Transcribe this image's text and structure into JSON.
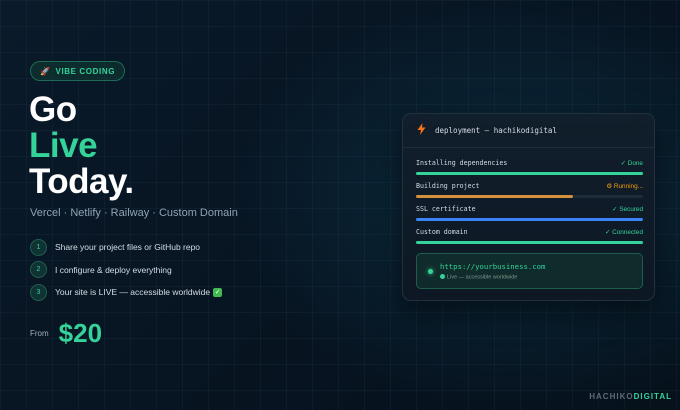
{
  "badge": {
    "icon": "rocket-icon",
    "label": "VIBE CODING"
  },
  "headline": {
    "line1": "Go",
    "line2": "Live",
    "line3": "Today."
  },
  "platforms": "Vercel · Netlify · Railway · Custom Domain",
  "steps": [
    {
      "num": "1",
      "text": "Share your project files or GitHub repo"
    },
    {
      "num": "2",
      "text": "I configure & deploy everything"
    },
    {
      "num": "3",
      "text": "Your site is LIVE — accessible worldwide",
      "check": "✓"
    }
  ],
  "price": {
    "from": "From",
    "amount": "$20"
  },
  "panel": {
    "icon": "lightning-bolt-icon",
    "title": "deployment — hachikodigital",
    "rows": [
      {
        "label": "Installing dependencies",
        "status": "✓ Done",
        "status_color": "#34d399",
        "bar_color": "#34d399",
        "progress": 1.0
      },
      {
        "label": "Building project",
        "status": "⚙ Running...",
        "status_color": "#f59e0b",
        "bar_color": "#d4903a",
        "progress": 0.69
      },
      {
        "label": "SSL certificate",
        "status": "✓ Secured",
        "status_color": "#34d399",
        "bar_color": "#3b82f6",
        "progress": 1.0
      },
      {
        "label": "Custom domain",
        "status": "✓ Connected",
        "status_color": "#34d399",
        "bar_color": "#34d399",
        "progress": 1.0
      }
    ],
    "url": "https://yourbusiness.com",
    "url_sub": "Live — accessible worldwide"
  },
  "brand": {
    "part1": "HACHIKO",
    "part2": "DIGITAL"
  },
  "colors": {
    "accent": "#34d399",
    "warning": "#f59e0b",
    "info": "#3b82f6",
    "bolt": "#f97316"
  }
}
